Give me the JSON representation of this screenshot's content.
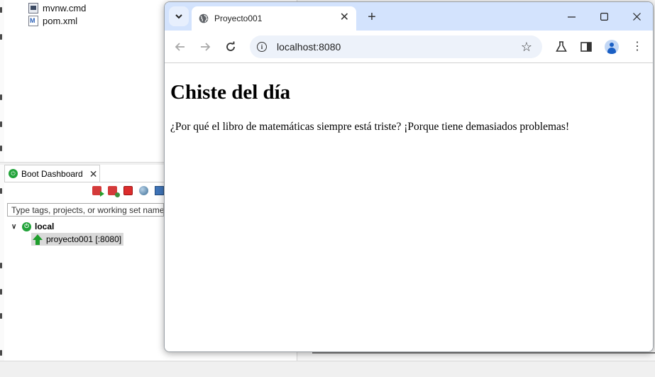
{
  "ide": {
    "tree_files": [
      {
        "name": "mvnw.cmd",
        "icon": "cmd-file-icon"
      },
      {
        "name": "pom.xml",
        "icon": "maven-pom-icon"
      }
    ],
    "boot_dashboard": {
      "tab_title": "Boot Dashboard",
      "filter_placeholder": "Type tags, projects, or working set names",
      "local_label": "local",
      "project_label": "proyecto001 [:8080]"
    }
  },
  "browser": {
    "tab_title": "Proyecto001",
    "url": "localhost:8080",
    "page": {
      "heading": "Chiste del día",
      "paragraph": "¿Por qué el libro de matemáticas siempre está triste? ¡Porque tiene demasiados problemas!"
    }
  },
  "colors": {
    "chrome_titlebar": "#d3e3fd",
    "omnibox": "#edf2fa",
    "boot_green": "#22a33a"
  }
}
